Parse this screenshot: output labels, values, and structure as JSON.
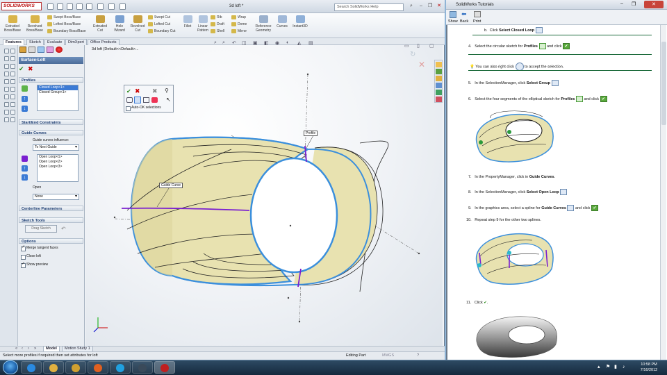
{
  "app": {
    "logo": "SOLIDWORKS",
    "document_title": "3d loft *",
    "help_search_placeholder": "Search SolidWorks Help"
  },
  "ribbon": {
    "big_buttons": [
      {
        "label": "Extruded Boss/Base",
        "icon": "extrude-boss-icon"
      },
      {
        "label": "Revolved Boss/Base",
        "icon": "revolve-boss-icon"
      },
      {
        "label": "Extruded Cut",
        "icon": "extrude-cut-icon"
      },
      {
        "label": "Hole Wizard",
        "icon": "hole-wizard-icon"
      },
      {
        "label": "Revolved Cut",
        "icon": "revolve-cut-icon"
      },
      {
        "label": "Fillet",
        "icon": "fillet-icon"
      },
      {
        "label": "Linear Pattern",
        "icon": "linear-pattern-icon"
      },
      {
        "label": "Reference Geometry",
        "icon": "reference-geometry-icon"
      },
      {
        "label": "Curves",
        "icon": "curves-icon"
      },
      {
        "label": "Instant3D",
        "icon": "instant3d-icon"
      }
    ],
    "small_buttons": [
      {
        "label": "Swept Boss/Base"
      },
      {
        "label": "Lofted Boss/Base"
      },
      {
        "label": "Boundary Boss/Base"
      },
      {
        "label": "Swept Cut"
      },
      {
        "label": "Lofted Cut"
      },
      {
        "label": "Boundary Cut"
      },
      {
        "label": "Rib"
      },
      {
        "label": "Draft"
      },
      {
        "label": "Shell"
      },
      {
        "label": "Wrap"
      },
      {
        "label": "Dome"
      },
      {
        "label": "Mirror"
      }
    ]
  },
  "tabs": [
    {
      "label": "Features",
      "active": true
    },
    {
      "label": "Sketch",
      "active": false
    },
    {
      "label": "Evaluate",
      "active": false
    },
    {
      "label": "DimXpert",
      "active": false
    },
    {
      "label": "Office Products",
      "active": false
    }
  ],
  "property_manager": {
    "title": "Surface-Loft",
    "profiles": {
      "header": "Profiles",
      "items": [
        "Closed Loop<1>",
        "Closed Group<1>"
      ]
    },
    "start_end": {
      "header": "Start/End Constraints"
    },
    "guide_curves": {
      "header": "Guide Curves",
      "influence_label": "Guide curves influence:",
      "influence_value": "To Next Guide",
      "items": [
        "Open Loop<1>",
        "Open Loop<2>",
        "Open Loop<3>"
      ],
      "open_label": "Open",
      "open_value": "None"
    },
    "centerline": {
      "header": "Centerline Parameters"
    },
    "sketch_tools": {
      "header": "Sketch Tools",
      "drag_sketch": "Drag Sketch"
    },
    "options": {
      "header": "Options",
      "checks": [
        {
          "label": "Merge tangent faces",
          "checked": true
        },
        {
          "label": "Close loft",
          "checked": false
        },
        {
          "label": "Show preview",
          "checked": true
        }
      ]
    }
  },
  "graphics": {
    "tree_label": "3d loft  (Default<<Default>...",
    "callouts": {
      "profile": "Profile",
      "guide": "Guide Curve"
    },
    "selection_manager": {
      "auto_ok": "Auto-OK selections"
    }
  },
  "bottom_tabs": [
    {
      "label": "Model",
      "active": true
    },
    {
      "label": "Motion Study 1",
      "active": false
    }
  ],
  "status_bar": {
    "message": "Select more profiles if required then set attributes for loft",
    "mode": "Editing Part",
    "units": "MMGS"
  },
  "help": {
    "window_title": "SolidWorks Tutorials",
    "toolbar": [
      "Show",
      "Back",
      "Print"
    ],
    "steps": [
      {
        "num": "b.",
        "text": "Click ",
        "bold": "Select Closed Loop",
        "after": ""
      },
      {
        "num": "4.",
        "text": "Select the circular sketch for ",
        "bold": "Profiles",
        "after": " and click"
      },
      {
        "num": "",
        "text": "You can also right click ",
        "bold": "",
        "after": " to accept the selection."
      },
      {
        "num": "5.",
        "text": "In the SelectionManager, click ",
        "bold": "Select Group",
        "after": ""
      },
      {
        "num": "6.",
        "text": "Select the four segments of the elliptical sketch for ",
        "bold": "Profiles",
        "after": " and click"
      },
      {
        "num": "7.",
        "text": "In the PropertyManager, click in ",
        "bold": "Guide Curves",
        "after": "."
      },
      {
        "num": "8.",
        "text": "In the SelectionManager, click ",
        "bold": "Select Open Loop",
        "after": ""
      },
      {
        "num": "9.",
        "text": "In the graphics area, select a spline for ",
        "bold": "Guide Curves",
        "after": " and click"
      },
      {
        "num": "10.",
        "text": "Repeat step 9 for the other two splines.",
        "bold": "",
        "after": ""
      },
      {
        "num": "11.",
        "text": "Click ",
        "bold": "",
        "after": "."
      }
    ]
  },
  "taskbar": {
    "apps": [
      "ie-icon",
      "explorer-icon",
      "media-player-icon",
      "firefox-icon",
      "skype-icon",
      "steam-icon",
      "solidworks-icon"
    ],
    "time": "10:58 PM",
    "date": "7/16/2012"
  },
  "colors": {
    "surface": "#e8e2b0",
    "edge_blue": "#3b8fdc",
    "guide_purple": "#7a1fd0",
    "accent": "#3a7ad5"
  }
}
